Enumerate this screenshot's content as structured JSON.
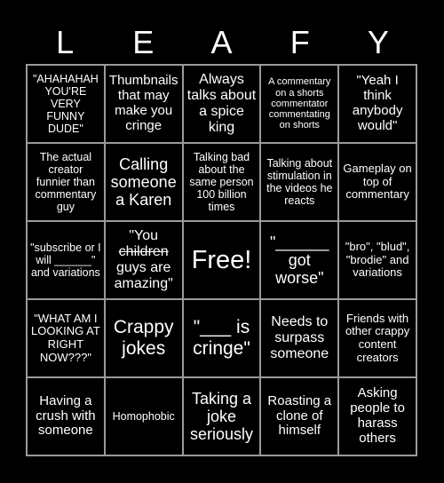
{
  "header": {
    "letters": [
      "L",
      "E",
      "A",
      "F",
      "Y"
    ]
  },
  "board": {
    "rows": [
      [
        "\"AHAHAHAH YOU'RE VERY FUNNY DUDE\"",
        "Thumbnails that may make you cringe",
        "Always talks about a spice king",
        "A commentary on a shorts commentator commentating on shorts",
        "\"Yeah I think anybody would\""
      ],
      [
        "The actual creator funnier than commentary guy",
        "Calling someone a Karen",
        "Talking bad about the same person 100 billion times",
        "Talking about stimulation in the videos he reacts",
        "Gameplay on top of commentary"
      ],
      [
        "\"subscribe or I will ______\" and variations",
        "\"You children guys are amazing\"",
        "Free!",
        "\"______ got worse\"",
        "\"bro\", \"blud\", \"brodie\" and variations"
      ],
      [
        "\"WHAT AM I LOOKING AT RIGHT NOW???\"",
        "Crappy jokes",
        "\"___ is cringe\"",
        "Needs to surpass someone",
        "Friends with other crappy content creators"
      ],
      [
        "Having a crush with someone",
        "Homophobic",
        "Taking a joke seriously",
        "Roasting a clone of himself",
        "Asking people to harass others"
      ]
    ],
    "cell_2_1_parts": {
      "before": "\"You ",
      "struck": "children",
      "after": " guys are amazing\""
    },
    "free_space": "Free!",
    "colors": {
      "background": "#000000",
      "text": "#ffffff",
      "grid_line": "#9a9a9a"
    }
  }
}
